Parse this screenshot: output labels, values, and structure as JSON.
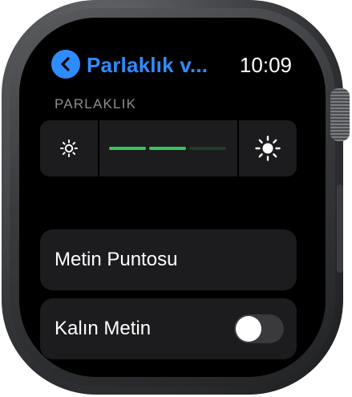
{
  "header": {
    "title": "Parlaklık v...",
    "time": "10:09"
  },
  "brightness": {
    "section_label": "PARLAKLIK",
    "level_segments_filled": 2,
    "segments_total": 3,
    "accent": "#34c759"
  },
  "text_size": {
    "label": "Metin Puntosu"
  },
  "bold_text": {
    "label": "Kalın Metin",
    "enabled": false
  },
  "colors": {
    "accent_blue": "#2f8cff",
    "track_off": "#1f3d26"
  },
  "icons": [
    "chevron-left-icon",
    "sun-low-icon",
    "sun-high-icon"
  ]
}
